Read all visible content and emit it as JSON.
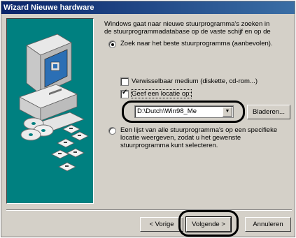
{
  "window": {
    "title": "Wizard Nieuwe hardware"
  },
  "intro": {
    "line1": "Windows gaat naar nieuwe stuurprogramma's zoeken in",
    "line2": "de stuurprogrammadatabase op de vaste schijf en op de"
  },
  "options": {
    "search_best": "Zoek naar het beste stuurprogramma (aanbevolen).",
    "removable_media": "Verwisselbaar medium (diskette, cd-rom...)",
    "specify_location": "Geef een locatie op:",
    "location_value": "D:\\Dutch\\Win98_Me",
    "browse_label": "Bladeren...",
    "list_line1": "Een lijst van alle stuurprogramma's op een specifieke",
    "list_line2": "locatie weergeven, zodat u het gewenste",
    "list_line3": "stuurprogramma kunt selecteren."
  },
  "state": {
    "search_best_selected": true,
    "removable_checked": false,
    "specify_checked": true,
    "list_selected": false
  },
  "buttons": {
    "back": "< Vorige",
    "next": "Volgende >",
    "cancel": "Annuleren"
  },
  "colors": {
    "titlebar": "#0a246a",
    "dialog": "#d4d0c8",
    "art_bg": "#008080"
  },
  "icons": {
    "computer": "computer-icon",
    "disc": "cd-icon",
    "diskette": "floppy-icon"
  }
}
